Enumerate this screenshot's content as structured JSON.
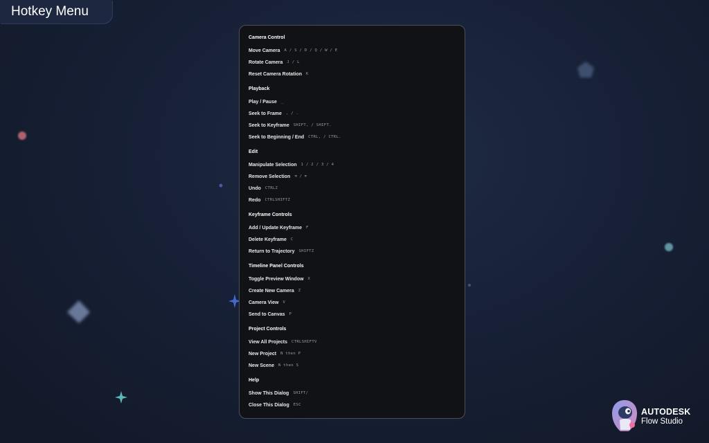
{
  "window": {
    "title": "Hotkey Menu"
  },
  "sections": [
    {
      "title": "Camera Control",
      "rows": [
        {
          "label": "Move Camera",
          "keys": "A / S / D / Q / W / E"
        },
        {
          "label": "Rotate Camera",
          "keys": "J / L"
        },
        {
          "label": "Reset Camera Rotation",
          "keys": "K"
        }
      ]
    },
    {
      "title": "Playback",
      "rows": [
        {
          "label": "Play / Pause",
          "keys": "_"
        },
        {
          "label": "Seek to Frame",
          "keys": ", / ."
        },
        {
          "label": "Seek to Keyframe",
          "keys": "SHIFT, / SHIFT."
        },
        {
          "label": "Seek to Beginning / End",
          "keys": "CTRL, / CTRL."
        }
      ]
    },
    {
      "title": "Edit",
      "rows": [
        {
          "label": "Manipulate Selection",
          "keys": "1 / 2 / 3 / 4"
        },
        {
          "label": "Remove Selection",
          "keys": "⌫ / ⌦"
        },
        {
          "label": "Undo",
          "keys": "CTRLZ"
        },
        {
          "label": "Redo",
          "keys": "CTRLSHIFTZ"
        }
      ]
    },
    {
      "title": "Keyframe Controls",
      "rows": [
        {
          "label": "Add / Update Keyframe",
          "keys": "F"
        },
        {
          "label": "Delete Keyframe",
          "keys": "C"
        },
        {
          "label": "Return to Trajectory",
          "keys": "SHIFTZ"
        }
      ]
    },
    {
      "title": "Timeline Panel Controls",
      "rows": [
        {
          "label": "Toggle Preview Window",
          "keys": "X"
        },
        {
          "label": "Create New Camera",
          "keys": "Z"
        },
        {
          "label": "Camera View",
          "keys": "V"
        },
        {
          "label": "Send to Canvas",
          "keys": "P"
        }
      ]
    },
    {
      "title": "Project Controls",
      "rows": [
        {
          "label": "View All Projects",
          "keys": "CTRLSHIFTV"
        },
        {
          "label": "New Project",
          "keys": "N then P"
        },
        {
          "label": "New Scene",
          "keys": "N then S"
        }
      ]
    },
    {
      "title": "Help",
      "rows": [
        {
          "label": "Show This Dialog",
          "keys": "SHIFT/"
        },
        {
          "label": "Close This Dialog",
          "keys": "ESC"
        }
      ]
    }
  ],
  "brand": {
    "name": "AUTODESK",
    "product": "Flow Studio",
    "icon": "flow-studio-logo-icon"
  },
  "colors": {
    "background": "#172036",
    "panel": "#111215",
    "panel_border": "#4b4f5a",
    "key_text": "#9a9ca3"
  }
}
